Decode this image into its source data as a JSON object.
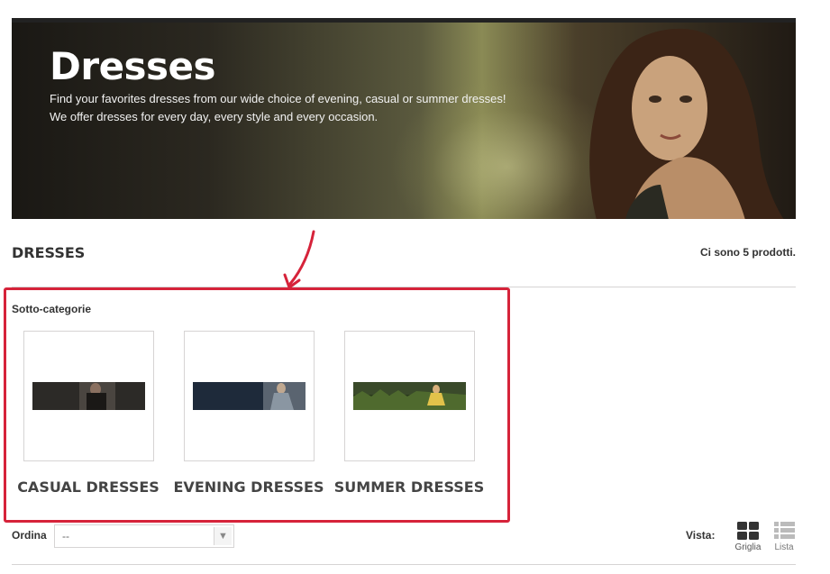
{
  "banner": {
    "title": "Dresses",
    "line1": "Find your favorites dresses from our wide choice of evening, casual or summer dresses!",
    "line2": "We offer dresses for every day, every style and every occasion."
  },
  "category": {
    "heading": "DRESSES",
    "count_text": "Ci sono 5 prodotti."
  },
  "subcategories": {
    "title": "Sotto-categorie",
    "items": [
      {
        "name": "CASUAL DRESSES"
      },
      {
        "name": "EVENING DRESSES"
      },
      {
        "name": "SUMMER DRESSES"
      }
    ]
  },
  "toolbar": {
    "sort_label": "Ordina",
    "sort_value": "--",
    "view_label": "Vista:",
    "grid_label": "Griglia",
    "list_label": "Lista"
  },
  "colors": {
    "highlight": "#d6233a",
    "divider": "#d6d4d4"
  },
  "icons": [
    "annotation-arrow-icon",
    "dropdown-arrow-icon",
    "grid-view-icon",
    "list-view-icon"
  ]
}
